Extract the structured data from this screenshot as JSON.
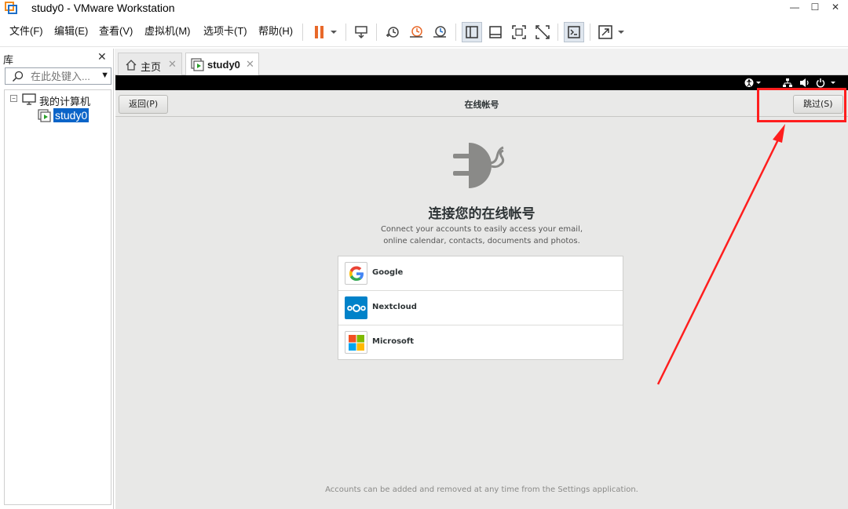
{
  "window": {
    "title": "study0 - VMware Workstation",
    "controls": {
      "minimize": "—",
      "maximize": "☐",
      "close": "✕"
    }
  },
  "menu": {
    "file": "文件(F)",
    "edit": "编辑(E)",
    "view": "查看(V)",
    "vm": "虚拟机(M)",
    "tabs": "选项卡(T)",
    "help": "帮助(H)"
  },
  "toolbar": {
    "icons": [
      "pause-icon",
      "send-keys-icon",
      "snapshot-icon",
      "revert-snapshot-icon",
      "snapshot-manager-icon",
      "library-toggle-icon",
      "thumbnail-bar-icon",
      "fullscreen-icon",
      "unity-icon",
      "console-icon",
      "stretch-icon"
    ],
    "accent": "#e8692a"
  },
  "library": {
    "title": "库",
    "close": "✕",
    "search_placeholder": "在此处键入...",
    "tree_toggle": "⊟",
    "root": "我的计算机",
    "vm": "study0"
  },
  "tabs": {
    "home": "主页",
    "vm": "study0",
    "close": "✕"
  },
  "guest": {
    "header": {
      "back": "返回(P)",
      "title": "在线帐号",
      "skip": "跳过(S)"
    },
    "heading": "连接您的在线帐号",
    "description_line1": "Connect your accounts to easily access your email,",
    "description_line2": "online calendar, contacts, documents and photos.",
    "providers": [
      {
        "name": "Google",
        "icon": "google-icon"
      },
      {
        "name": "Nextcloud",
        "icon": "nextcloud-icon"
      },
      {
        "name": "Microsoft",
        "icon": "microsoft-icon"
      }
    ],
    "footer": "Accounts can be added and removed at any time from the Settings application."
  },
  "annotation": {
    "highlight_color": "#ff1e1e"
  }
}
